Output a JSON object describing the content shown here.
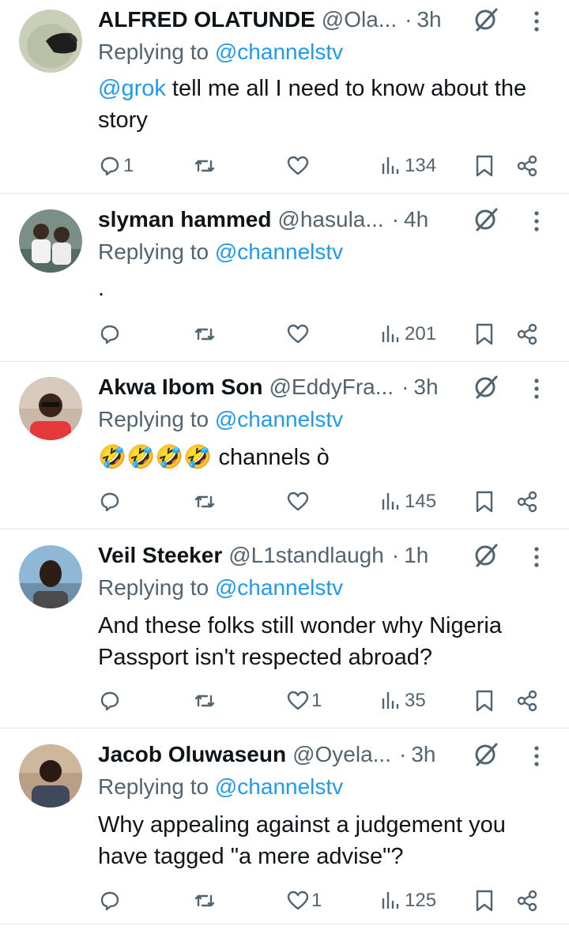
{
  "replies": [
    {
      "name": "ALFRED OLATUNDE",
      "handle": "@Ola...",
      "dot": "·",
      "time": "3h",
      "replying_prefix": "Replying to ",
      "replying_to": "@channelstv",
      "text_mention": "@grok",
      "text": " tell me all I need to know about the story",
      "replies_count": "1",
      "retweets_count": "",
      "likes_count": "",
      "views_count": "134"
    },
    {
      "name": "slyman hammed",
      "handle": "@hasula...",
      "dot": "·",
      "time": "4h",
      "replying_prefix": "Replying to ",
      "replying_to": "@channelstv",
      "text_mention": "",
      "text": ".",
      "replies_count": "",
      "retweets_count": "",
      "likes_count": "",
      "views_count": "201"
    },
    {
      "name": "Akwa Ibom Son",
      "handle": "@EddyFra...",
      "dot": "·",
      "time": "3h",
      "replying_prefix": "Replying to ",
      "replying_to": "@channelstv",
      "text_mention": "",
      "text": "🤣🤣🤣🤣 channels ò",
      "replies_count": "",
      "retweets_count": "",
      "likes_count": "",
      "views_count": "145"
    },
    {
      "name": "Veil Steeker",
      "handle": "@L1standlaugh",
      "dot": "·",
      "time": "1h",
      "replying_prefix": "Replying to ",
      "replying_to": "@channelstv",
      "text_mention": "",
      "text": "And these folks still wonder why Nigeria Passport isn't respected abroad?",
      "replies_count": "",
      "retweets_count": "",
      "likes_count": "1",
      "views_count": "35"
    },
    {
      "name": "Jacob Oluwaseun",
      "handle": "@Oyela...",
      "dot": "·",
      "time": "3h",
      "replying_prefix": "Replying to ",
      "replying_to": "@channelstv",
      "text_mention": "",
      "text": "Why appealing against a judgement you have tagged \"a mere advise\"?",
      "replies_count": "",
      "retweets_count": "",
      "likes_count": "1",
      "views_count": "125"
    }
  ],
  "colors": {
    "text": "#0f1419",
    "secondary": "#536471",
    "accent": "#1d9bf0",
    "divider": "#e3e6e9"
  },
  "icons": [
    "grok-icon",
    "more-icon",
    "reply-icon",
    "retweet-icon",
    "like-icon",
    "views-icon",
    "bookmark-icon",
    "share-icon"
  ]
}
